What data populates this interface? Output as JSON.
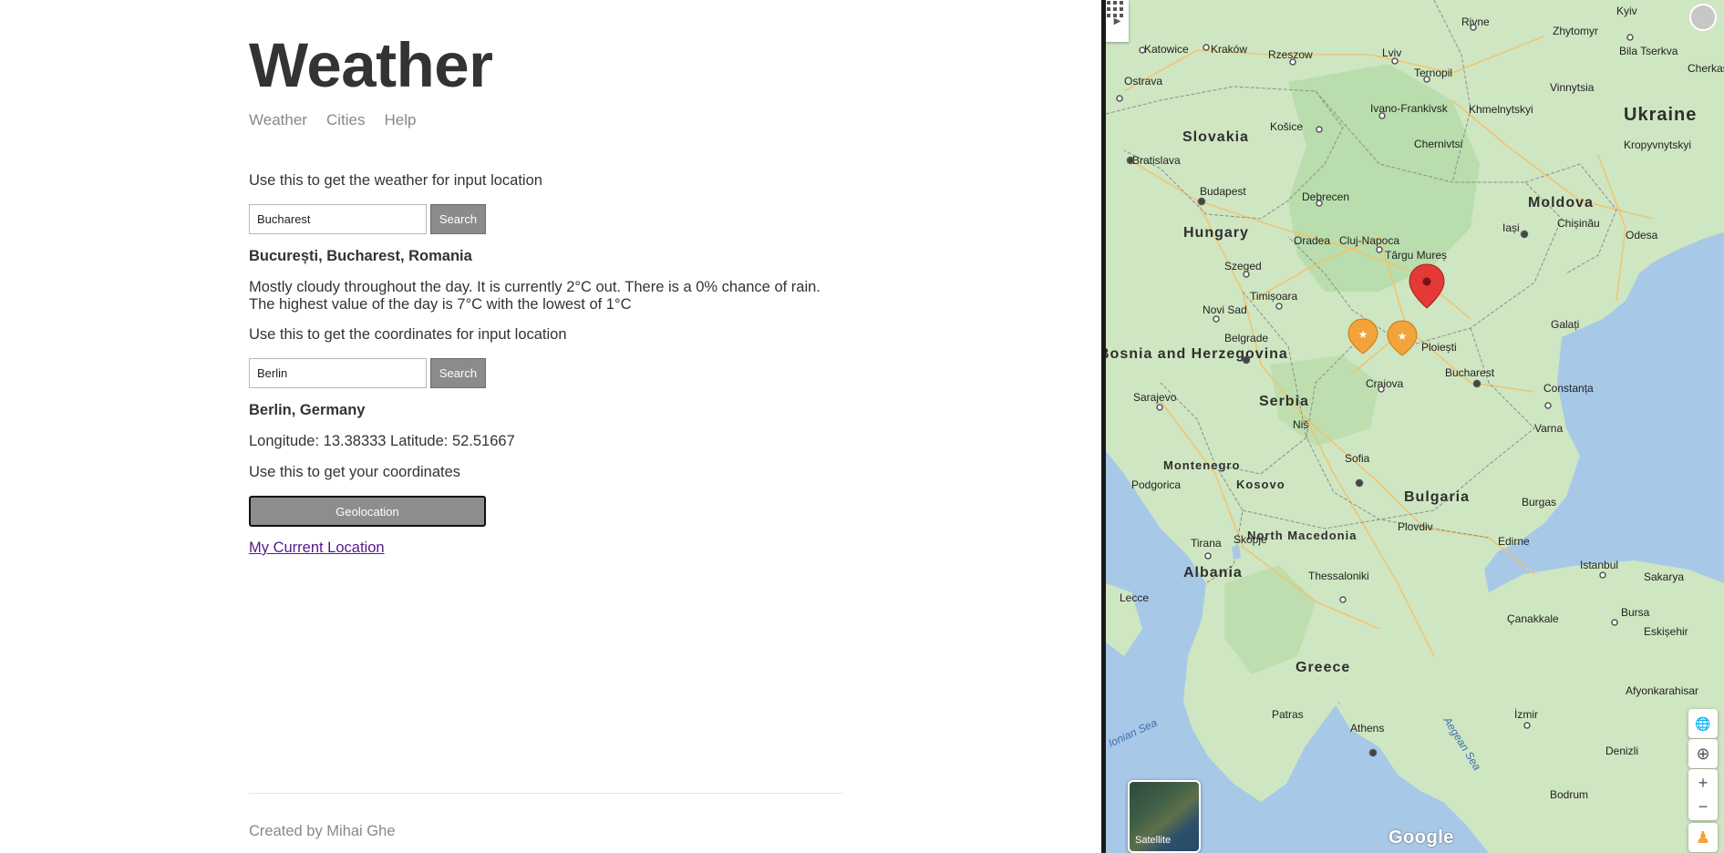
{
  "site": {
    "title": "Weather"
  },
  "nav": [
    {
      "label": "Weather"
    },
    {
      "label": "Cities"
    },
    {
      "label": "Help"
    }
  ],
  "weather_section": {
    "prompt": "Use this to get the weather for input location",
    "input_value": "Bucharest",
    "button_label": "Search",
    "result_title": "București, Bucharest, Romania",
    "result_text": "Mostly cloudy throughout the day. It is currently 2°C out. There is a 0% chance of rain. The highest value of the day is 7°C with the lowest of 1°C"
  },
  "coords_section": {
    "prompt": "Use this to get the coordinates for input location",
    "input_value": "Berlin",
    "button_label": "Search",
    "result_title": "Berlin, Germany",
    "result_text": "Longitude: 13.38333 Latitude: 52.51667"
  },
  "geo_section": {
    "prompt": "Use this to get your coordinates",
    "button_label": "Geolocation",
    "link_label": "My Current Location"
  },
  "footer": {
    "text": "Created by Mihai Ghe"
  },
  "map": {
    "countries": [
      "Slovakia",
      "Hungary",
      "Ukraine",
      "Moldova",
      "Serbia",
      "Bulgaria",
      "Albania",
      "Greece",
      "Montenegro",
      "Kosovo",
      "North Macedonia",
      "Bosnia and Herzegovina"
    ],
    "cities": [
      "Kraków",
      "Katowice",
      "Ostrava",
      "Rzeszow",
      "Lviv",
      "Rivne",
      "Zhytomyr",
      "Kyiv",
      "Bila Tserkva",
      "Ternopil",
      "Ivano-Frankivsk",
      "Khmelnytskyi",
      "Vinnytsia",
      "Chernivtsi",
      "Cherkasy",
      "Kropyvnytskyi",
      "Košice",
      "Bratislava",
      "Budapest",
      "Debrecen",
      "Oradea",
      "Cluj-Napoca",
      "Târgu Mureș",
      "Iași",
      "Chișinău",
      "Odesa",
      "Szeged",
      "Timișoara",
      "Novi Sad",
      "Belgrade",
      "Craiova",
      "Ploiești",
      "Bucharest",
      "Galați",
      "Constanța",
      "Varna",
      "Sarajevo",
      "Niš",
      "Sofia",
      "Plovdiv",
      "Burgas",
      "Podgorica",
      "Tirana",
      "Skopje",
      "Thessaloniki",
      "Edirne",
      "Istanbul",
      "Sakarya",
      "Bursa",
      "Eskișehir",
      "Lecce",
      "Patras",
      "Athens",
      "İzmir",
      "Denizli",
      "Afyonkarahisar",
      "Bodrum",
      "Çanakkale"
    ],
    "seas": [
      "Aegean Sea",
      "Ionian Sea"
    ],
    "satellite_label": "Satellite",
    "brand": "Google"
  }
}
